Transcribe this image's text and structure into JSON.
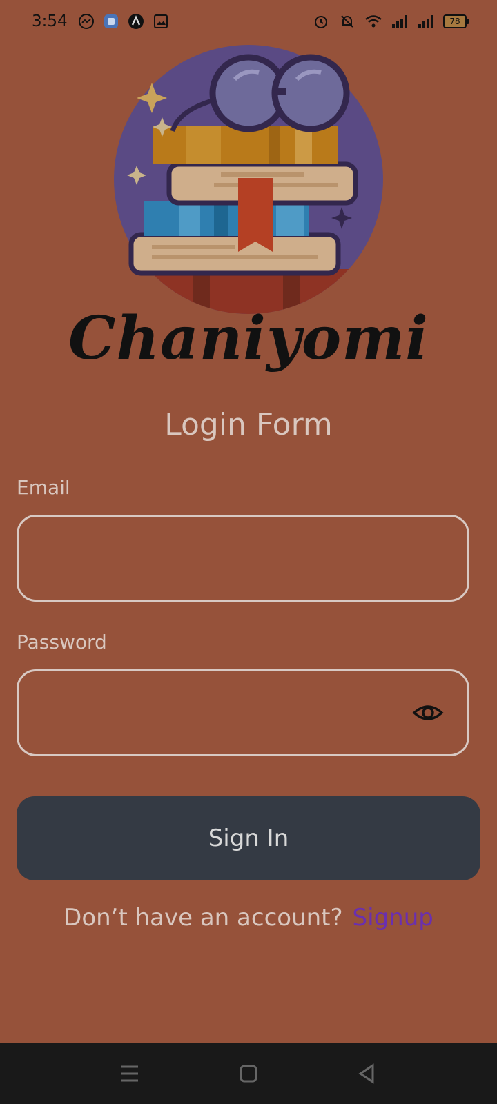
{
  "status_bar": {
    "time": "3:54",
    "battery_level": "78",
    "left_icons": [
      "messenger-icon",
      "app-icon",
      "artist-icon",
      "gallery-icon"
    ],
    "right_icons": [
      "alarm-icon",
      "mute-icon",
      "wifi-icon",
      "signal-icon",
      "signal-icon",
      "battery-icon"
    ]
  },
  "app": {
    "brand_name": "Chaniyomi",
    "logo": "books-glasses-logo"
  },
  "form": {
    "title": "Login Form",
    "email_label": "Email",
    "email_value": "",
    "password_label": "Password",
    "password_value": "",
    "signin_label": "Sign In",
    "signup_prompt": "Don’t have an account?",
    "signup_link": "Signup"
  },
  "nav_bar": {
    "items": [
      "menu-icon",
      "home-icon",
      "back-icon"
    ]
  },
  "colors": {
    "background": "#96523a",
    "button": "#343a44",
    "link": "#6a2fb0"
  }
}
